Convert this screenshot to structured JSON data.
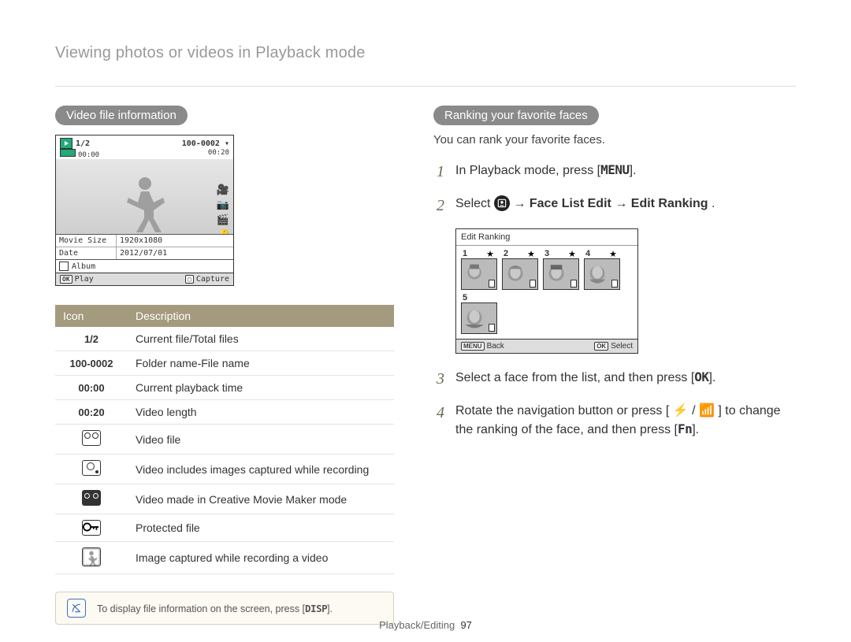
{
  "breadcrumb": "Viewing photos or videos in Playback mode",
  "footer": {
    "section": "Playback/Editing",
    "page": "97"
  },
  "left": {
    "heading": "Video file information",
    "screen": {
      "file_index": "1/2",
      "file_name": "100-0002",
      "time_current": "00:00",
      "time_total": "00:20",
      "movie_size_label": "Movie Size",
      "movie_size_value": "1920x1080",
      "date_label": "Date",
      "date_value": "2012/07/01",
      "album_label": "Album",
      "bottom_left_key": "OK",
      "bottom_left_label": "Play",
      "bottom_right_label": "Capture"
    },
    "table": {
      "head_icon": "Icon",
      "head_desc": "Description",
      "rows": [
        {
          "icon": "1/2",
          "desc": "Current file/Total files"
        },
        {
          "icon": "100-0002",
          "desc": "Folder name-File name"
        },
        {
          "icon": "00:00",
          "desc": "Current playback time"
        },
        {
          "icon": "00:20",
          "desc": "Video length"
        },
        {
          "icon": "video-file-icon",
          "desc": "Video file"
        },
        {
          "icon": "captured-images-icon",
          "desc": "Video includes images captured while recording"
        },
        {
          "icon": "creative-movie-icon",
          "desc": "Video made in Creative Movie Maker mode"
        },
        {
          "icon": "protected-icon",
          "desc": "Protected file"
        },
        {
          "icon": "silhouette-icon",
          "desc": "Image captured while recording a video"
        }
      ]
    },
    "note": {
      "text_a": "To display file information on the screen, press [",
      "key": "DISP",
      "text_b": "]."
    }
  },
  "right": {
    "heading": "Ranking your favorite faces",
    "desc": "You can rank your favorite faces.",
    "steps": {
      "s1": {
        "a": "In Playback mode, press [",
        "key": "MENU",
        "b": "]."
      },
      "s2": {
        "a": "Select ",
        "b": " → ",
        "c": "Face List Edit",
        "d": " → ",
        "e": "Edit Ranking",
        "f": "."
      },
      "s3": {
        "a": "Select a face from the list, and then press [",
        "key": "OK",
        "b": "]."
      },
      "s4": {
        "a": "Rotate the navigation button or press [",
        "b": "/",
        "c": "] to change the ranking of the face, and then press [",
        "key": "Fn",
        "d": "]."
      }
    },
    "rank_screen": {
      "title": "Edit Ranking",
      "faces": [
        "1",
        "2",
        "3",
        "4",
        "5"
      ],
      "back_key": "MENU",
      "back_label": "Back",
      "select_key": "OK",
      "select_label": "Select"
    }
  }
}
